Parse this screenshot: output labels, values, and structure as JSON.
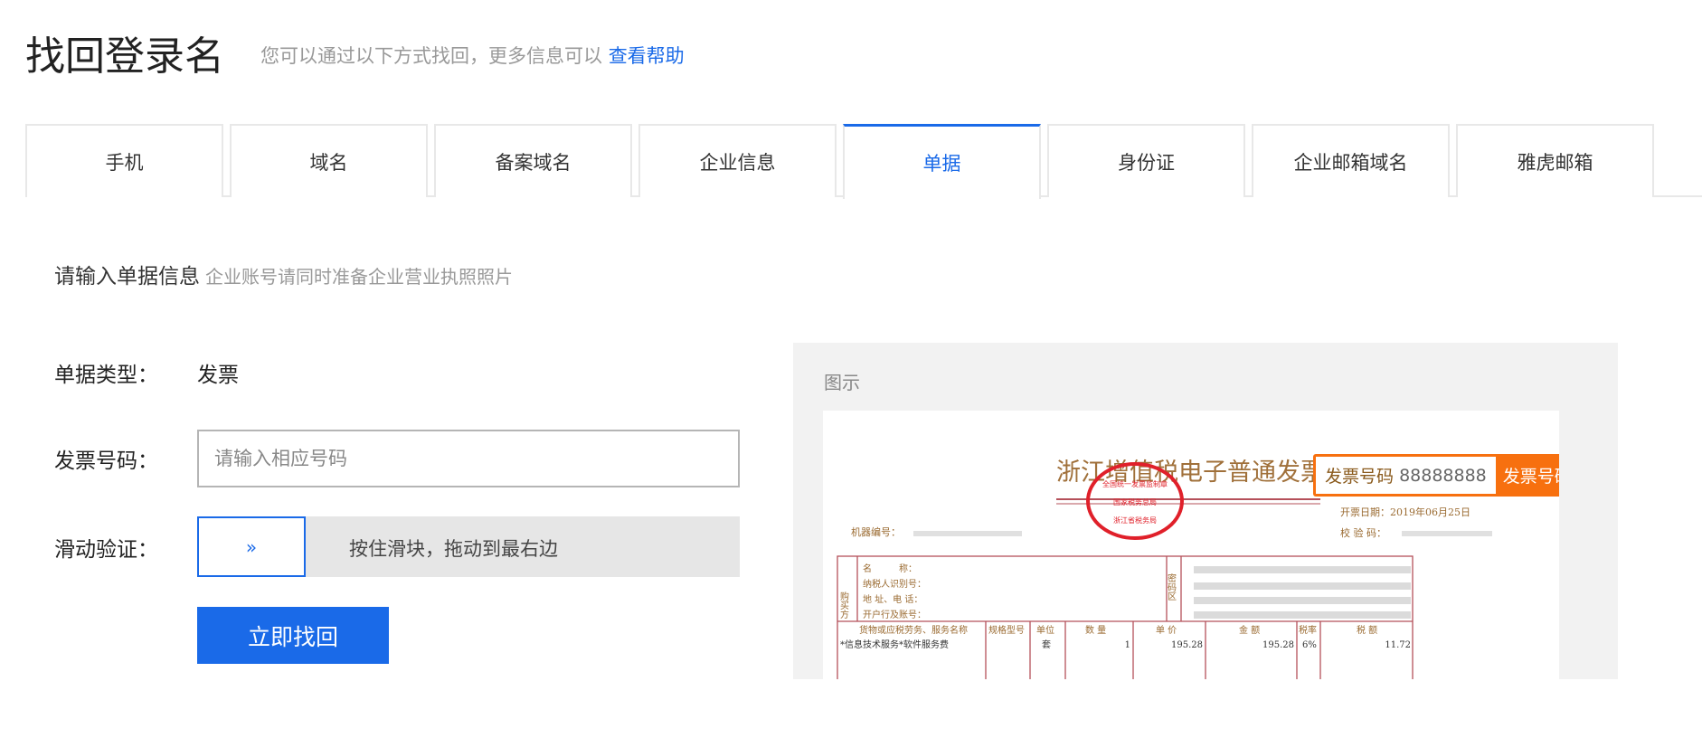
{
  "header": {
    "title": "找回登录名",
    "subtitle": "您可以通过以下方式找回，更多信息可以",
    "help_link": "查看帮助"
  },
  "tabs": [
    {
      "label": "手机"
    },
    {
      "label": "域名"
    },
    {
      "label": "备案域名"
    },
    {
      "label": "企业信息"
    },
    {
      "label": "单据",
      "active": true
    },
    {
      "label": "身份证"
    },
    {
      "label": "企业邮箱域名"
    },
    {
      "label": "雅虎邮箱"
    }
  ],
  "form": {
    "section_title": "请输入单据信息",
    "section_hint": "企业账号请同时准备企业营业执照照片",
    "type_label": "单据类型：",
    "type_value": "发票",
    "number_label": "发票号码：",
    "number_value": "",
    "number_placeholder": "请输入相应号码",
    "slider_label": "滑动验证：",
    "slider_handle": "»",
    "slider_text": "按住滑块，拖动到最右边",
    "submit_label": "立即找回"
  },
  "example": {
    "label": "图示",
    "callout_field": "发票号码",
    "callout_value": "88888888",
    "callout_tag": "发票号码",
    "invoice": {
      "title": "浙江增值税电子普通发票",
      "seal_top": "全国统一发票监制章",
      "seal_mid": "国家税务总局",
      "seal_bottom": "浙江省税务局",
      "date": "开票日期：2019年06月25日",
      "check_code": "校 验 码：",
      "machine_no": "机器编号：",
      "buyer": "购买方",
      "name": "名　　　称：",
      "tax_id": "纳税人识别号：",
      "address": "地 址、电 话：",
      "bank": "开户行及账号：",
      "cipher": "密码区",
      "cols": [
        "货物或应税劳务、服务名称",
        "规格型号",
        "单位",
        "数 量",
        "单 价",
        "金 额",
        "税率",
        "税 额"
      ],
      "row": [
        "*信息技术服务*软件服务费",
        "",
        "套",
        "1",
        "195.28",
        "195.28",
        "6%",
        "11.72"
      ]
    }
  },
  "colors": {
    "accent": "#1a6ae8",
    "callout": "#f7700f",
    "invoice_line": "#b5505a",
    "invoice_text": "#9a6a30",
    "seal": "#e0202a"
  }
}
